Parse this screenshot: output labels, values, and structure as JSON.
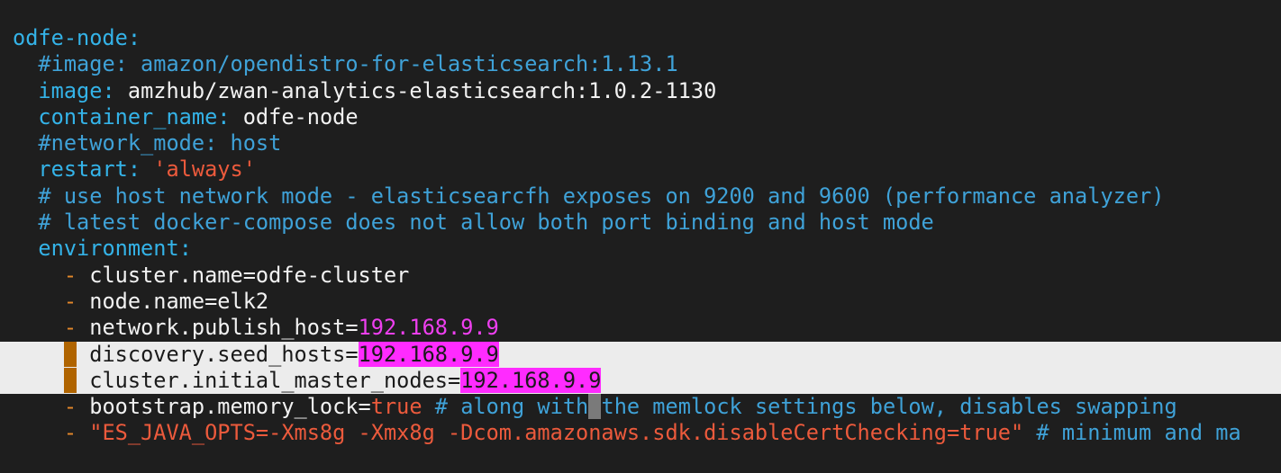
{
  "editor": {
    "lines": {
      "l0": {
        "key": "odfe-node",
        "colon": ":"
      },
      "l1": {
        "comment": "#image: amazon/opendistro-for-elasticsearch:1.13.1"
      },
      "l2": {
        "key": "image",
        "colon": ":",
        "value": " amzhub/zwan-analytics-elasticsearch:1.0.2-1130"
      },
      "l3": {
        "key": "container_name",
        "colon": ":",
        "value": " odfe-node"
      },
      "l4": {
        "comment": "#network_mode: host"
      },
      "l5": {
        "key": "restart",
        "colon": ":",
        "value": " 'always'"
      },
      "l6": {
        "comment": "# use host network mode - elasticsearcfh exposes on 9200 and 9600 (performance analyzer)"
      },
      "l7": {
        "comment": "# latest docker-compose does not allow both port binding and host mode"
      },
      "l8": {
        "key": "environment",
        "colon": ":"
      },
      "l9": {
        "dash": "-",
        "value": " cluster.name=odfe-cluster"
      },
      "l10": {
        "dash": "-",
        "value": " node.name=elk2"
      },
      "l11": {
        "dash": "-",
        "value": " network.publish_host=",
        "ip": "192.168.9.9"
      },
      "l12": {
        "dash": "-",
        "value": " discovery.seed_hosts=",
        "ip": "192.168.9.9"
      },
      "l13": {
        "dash": "-",
        "value": " cluster.initial_master_nodes=",
        "ip": "192.168.9.9"
      },
      "l14": {
        "dash": "-",
        "value": " bootstrap.memory_lock=",
        "bool": "true",
        "comment_a": " # along with",
        "cursor": " ",
        "comment_b": "the memlock settings below, disables swapping"
      },
      "l15": {
        "dash": "-",
        "value": " \"ES_JAVA_OPTS=-Xms8g -Xmx8g -Dcom.amazonaws.sdk.disableCertChecking=true\"",
        "comment": " # minimum and ma"
      }
    }
  },
  "colors": {
    "background": "#1e1e1e",
    "key": "#34b3e8",
    "comment": "#3fa2d8",
    "dash": "#e4882a",
    "string": "#ec5a3c",
    "ip": "#ee3ff0",
    "ip_highlight": "#ff2bff",
    "selection": "#ececec"
  }
}
